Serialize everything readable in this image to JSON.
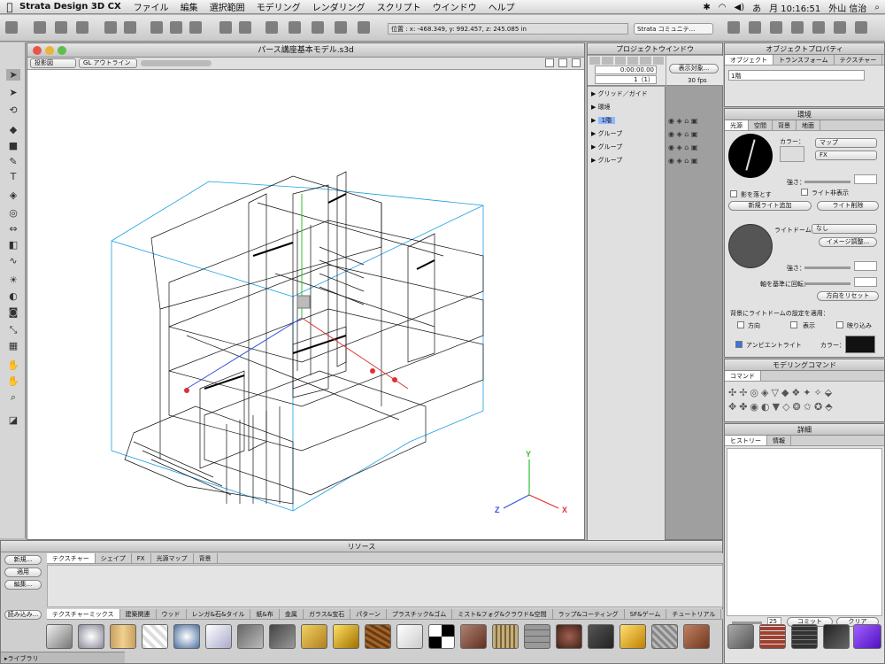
{
  "menubar": {
    "app": "Strata Design 3D CX",
    "items": [
      "ファイル",
      "編集",
      "選択範囲",
      "モデリング",
      "レンダリング",
      "スクリプト",
      "ウインドウ",
      "ヘルプ"
    ],
    "clock": "月 10:16:51",
    "user": "外山 信治"
  },
  "toolbar": {
    "coordinates": "位置 : x: -468.349, y: 992.457, z: 245.085 in",
    "community": "Strata コミュニテ..."
  },
  "document": {
    "title": "パース講座基本モデル.s3d",
    "view_menu": "投影図",
    "render_menu": "GL アウトライン"
  },
  "project_window": {
    "title": "プロジェクトウインドウ",
    "timecode": "0:00:00.00",
    "frame": "1（1）",
    "display_label": "表示対象...",
    "fps": "30 fps",
    "items": [
      {
        "label": "グリッド／ガイド",
        "selected": false,
        "icons": false
      },
      {
        "label": "環境",
        "selected": false,
        "icons": false
      },
      {
        "label": "1階",
        "selected": true,
        "icons": true
      },
      {
        "label": "グループ",
        "selected": false,
        "icons": true
      },
      {
        "label": "グループ",
        "selected": false,
        "icons": true
      },
      {
        "label": "グループ",
        "selected": false,
        "icons": true
      }
    ]
  },
  "object_properties": {
    "title": "オブジェクトプロパティ",
    "tabs": [
      "オブジェクト",
      "トランスフォーム",
      "テクスチャー"
    ],
    "name_value": "1階"
  },
  "environment": {
    "title": "環境",
    "tabs": [
      "光源",
      "空間",
      "背景",
      "地面"
    ],
    "color_label": "カラー：",
    "map_option": "マップ",
    "fx_option": "FX",
    "intensity_label": "強さ：",
    "shadow_label": "影を落とす",
    "light_hidden_label": "ライト非表示",
    "add_light": "新規ライト追加",
    "delete_light": "ライト削除",
    "light_dome_label": "ライトドーム：",
    "light_dome_value": "なし",
    "image_adjust": "イメージ調整...",
    "intensity2_label": "強さ：",
    "rotate_label": "軸を基準に回転：",
    "reset_direction": "方向をリセット",
    "bg_apply_label": "背景にライトドームの設定を適用：",
    "direction_label": "方向",
    "display_label": "表示",
    "reflect_label": "映り込み",
    "ambient_label": "アンビエントライト",
    "ambient_color_label": "カラー："
  },
  "modeling": {
    "title": "モデリングコマンド",
    "tab": "コマンド"
  },
  "detail": {
    "title": "詳細",
    "tabs": [
      "ヒストリー",
      "情報"
    ],
    "count": "25",
    "commit": "コミット",
    "clear": "クリア"
  },
  "resources": {
    "title": "リソース",
    "tabs": [
      "テクスチャー",
      "シェイプ",
      "FX",
      "光源マップ",
      "背景"
    ],
    "new_button": "新規...",
    "apply_button": "適用",
    "edit_button": "編集...",
    "load_button": "読み込み...",
    "library_label": "ライブラリ",
    "categories": [
      "テクスチャーミックス",
      "建築関連",
      "ウッド",
      "レンガ&石&タイル",
      "紙&布",
      "金属",
      "ガラス&宝石",
      "パターン",
      "プラスチック&ゴム",
      "ミスト&フォグ&クラウド&空間",
      "ラップ&コーティング",
      "SF&ゲーム",
      "チュートリアル"
    ]
  },
  "axes": {
    "x": "X",
    "y": "Y",
    "z": "Z"
  },
  "colors": {
    "selection": "#8fb8ff",
    "bounding": "#1aa0e0",
    "axis_x": "#e03030",
    "axis_y": "#30c030",
    "axis_z": "#3050e0"
  }
}
